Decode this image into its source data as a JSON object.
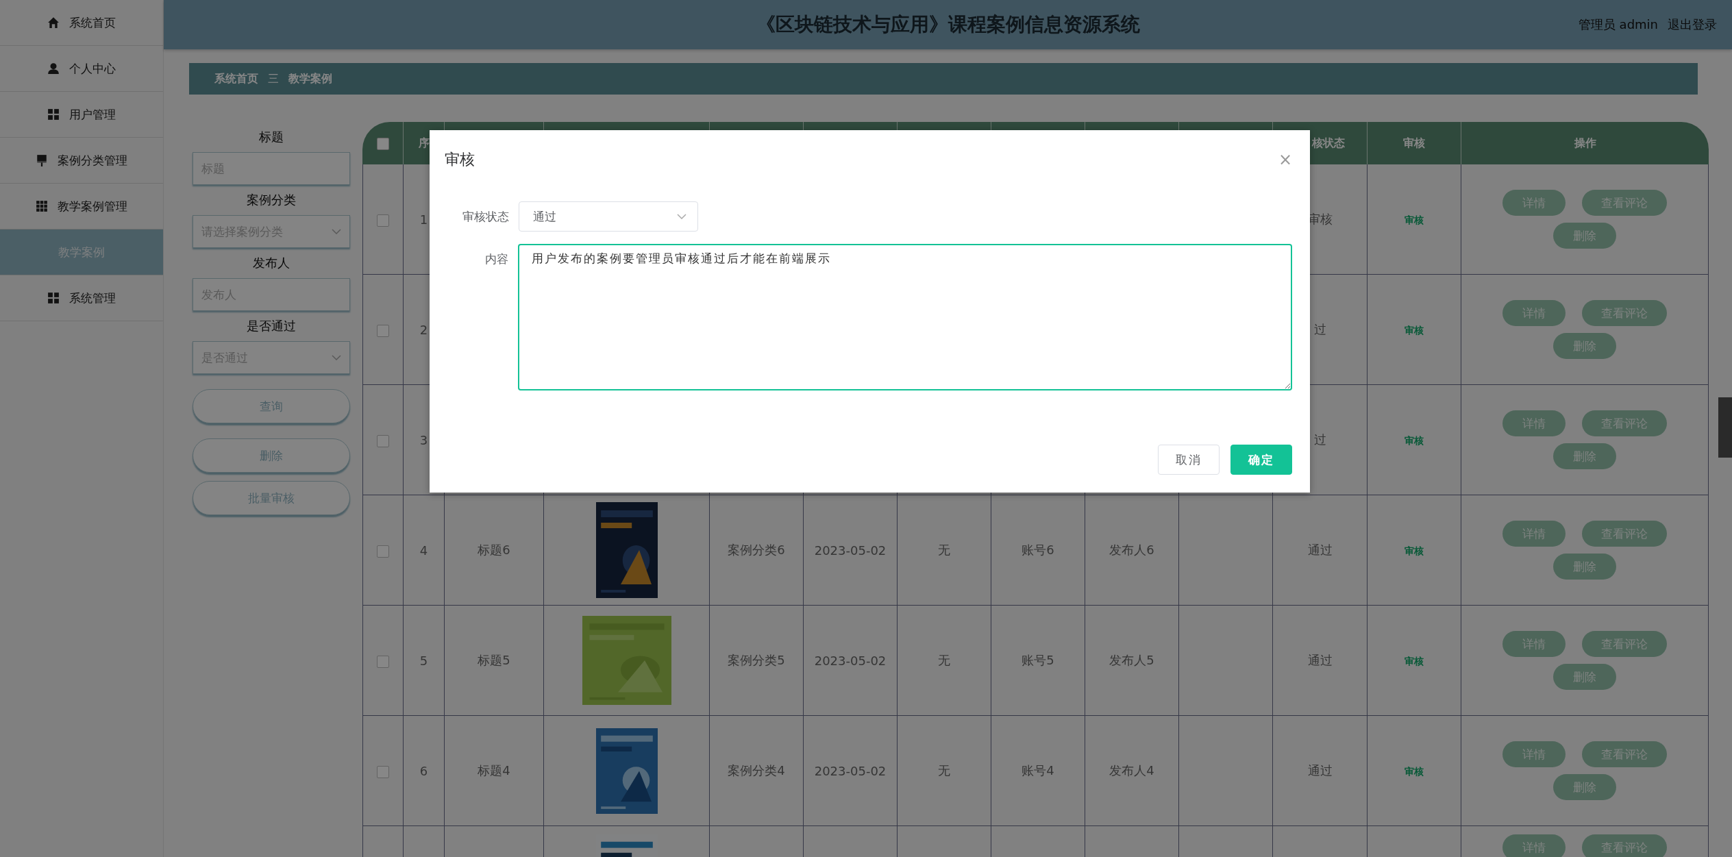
{
  "sidebar": {
    "items": [
      {
        "kind": "menu",
        "label": "系统首页",
        "selected": false
      },
      {
        "kind": "menu",
        "label": "个人中心",
        "selected": false
      },
      {
        "kind": "menu",
        "label": "用户管理",
        "selected": false
      },
      {
        "kind": "menu",
        "label": "案例分类管理",
        "selected": false
      },
      {
        "kind": "menu",
        "label": "教学案例管理",
        "selected": false
      },
      {
        "kind": "submenu",
        "label": "教学案例",
        "selected": true
      },
      {
        "kind": "menu",
        "label": "系统管理",
        "selected": false
      }
    ]
  },
  "header": {
    "title": "《区块链技术与应用》课程案例信息资源系统",
    "user": "管理员 admin",
    "logout": "退出登录"
  },
  "breadcrumb": {
    "home": "系统首页",
    "separator": "三",
    "current": "教学案例"
  },
  "filters": [
    {
      "kind": "input",
      "label": "标题",
      "placeholder": "标题"
    },
    {
      "kind": "select",
      "label": "案例分类",
      "placeholder": "请选择案例分类"
    },
    {
      "kind": "input",
      "label": "发布人",
      "placeholder": "发布人"
    },
    {
      "kind": "select",
      "label": "是否通过",
      "placeholder": "是否通过"
    }
  ],
  "filter_buttons": [
    "查询",
    "删除",
    "批量审核"
  ],
  "table": {
    "header_checkbox": {
      "checked": false
    },
    "columns": [
      {
        "label": "序"
      },
      {},
      {},
      {},
      {},
      {},
      {},
      {},
      {},
      {
        "label": "核状态"
      },
      {
        "label": "审核"
      },
      {
        "label": "操作"
      }
    ],
    "rows": [
      {
        "checked": false,
        "number": "1",
        "status": "审核",
        "review": "审核",
        "actions": [
          "详情",
          "查看评论",
          "删除"
        ]
      },
      {
        "checked": false,
        "number": "2",
        "status": "过",
        "review": "审核",
        "actions": [
          "详情",
          "查看评论",
          "删除"
        ]
      },
      {
        "checked": false,
        "number": "3",
        "status": "过",
        "review": "审核",
        "actions": [
          "详情",
          "查看评论",
          "删除"
        ]
      },
      {
        "checked": false,
        "number": "4",
        "title": "标题6",
        "image": {
          "kind": "picture"
        },
        "category": "案例分类6",
        "date": "2023-05-02",
        "column_7": "无",
        "account": "账号6",
        "publisher": "发布人6",
        "status": "通过",
        "review": "审核",
        "actions": [
          "详情",
          "查看评论",
          "删除"
        ]
      },
      {
        "checked": false,
        "number": "5",
        "title": "标题5",
        "image": {
          "kind": "picture"
        },
        "category": "案例分类5",
        "date": "2023-05-02",
        "column_7": "无",
        "account": "账号5",
        "publisher": "发布人5",
        "status": "通过",
        "review": "审核",
        "actions": [
          "详情",
          "查看评论",
          "删除"
        ]
      },
      {
        "checked": false,
        "number": "6",
        "title": "标题4",
        "image": {
          "kind": "picture"
        },
        "category": "案例分类4",
        "date": "2023-05-02",
        "column_7": "无",
        "account": "账号4",
        "publisher": "发布人4",
        "status": "通过",
        "review": "审核",
        "actions": [
          "详情",
          "查看评论",
          "删除"
        ]
      },
      {
        "image": {
          "kind": "picture"
        },
        "actions": [
          "详情",
          "查看评论"
        ]
      }
    ]
  },
  "dialog": {
    "title": "审核",
    "close": "×",
    "fields": [
      {
        "kind": "select",
        "label": "审核状态",
        "value": "通过"
      },
      {
        "kind": "textarea",
        "label": "内容",
        "value": "用户发布的案例要管理员审核通过后才能在前端展示"
      }
    ],
    "buttons": [
      {
        "label": "取消",
        "primary": false
      },
      {
        "label": "确定",
        "primary": true
      }
    ]
  }
}
